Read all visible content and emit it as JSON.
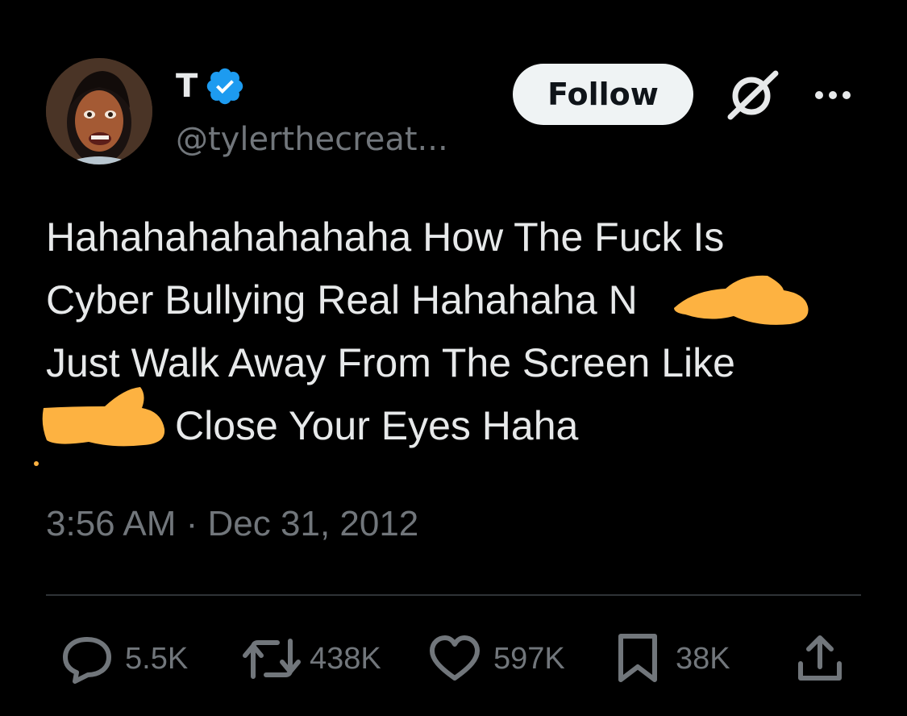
{
  "author": {
    "display_name": "T",
    "handle": "@tylerthecreat...",
    "verified": true,
    "avatar_icon": "avatar-image"
  },
  "header": {
    "follow_label": "Follow",
    "grok_icon": "grok-icon",
    "more_icon": "more-dots-icon"
  },
  "tweet": {
    "lines": [
      "Hahahahahahahaha How The Fuck Is",
      "Cyber Bullying Real Hahahaha N",
      "Just Walk Away From The Screen Like",
      "Close Your Eyes Haha"
    ],
    "redaction_color": "#FDB241",
    "timestamp": "3:56 AM · Dec 31, 2012"
  },
  "actions": {
    "replies": "5.5K",
    "reposts": "438K",
    "likes": "597K",
    "bookmarks": "38K",
    "reply_icon": "reply-icon",
    "repost_icon": "repost-icon",
    "like_icon": "heart-icon",
    "bookmark_icon": "bookmark-icon",
    "share_icon": "share-icon"
  },
  "colors": {
    "background": "#000000",
    "text": "#e7e9ea",
    "muted": "#71767b",
    "verified_blue": "#1d9bf0",
    "follow_bg": "#eff3f4"
  }
}
